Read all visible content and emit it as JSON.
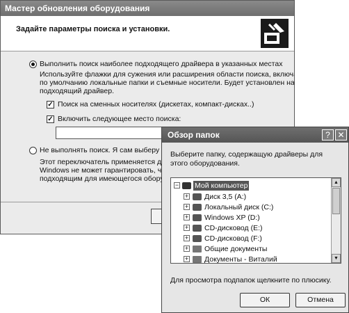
{
  "wizard": {
    "title": "Мастер обновления оборудования",
    "header_title": "Задайте параметры поиска и установки.",
    "option1_label": "Выполнить поиск наиболее подходящего драйвера в указанных местах",
    "option1_desc": [
      "Используйте флажки для сужения или расширения области поиска, включающей",
      "по умолчанию локальные папки и съемные носители. Будет установлен наиболее",
      "подходящий драйвер."
    ],
    "check_removable_label": "Поиск на сменных носителях (дискетах, компакт-дисках..)",
    "check_include_label": "Включить следующее место поиска:",
    "path_value": "",
    "option2_label": "Не выполнять поиск. Я сам выберу нужн",
    "option2_desc": [
      "Этот переключатель применяется для вы",
      "Windows не может гарантировать, что вы",
      "подходящим для имеющегося оборудова"
    ]
  },
  "browse": {
    "title": "Обзор папок",
    "help_btn": "?",
    "close_btn": "✕",
    "description": "Выберите папку, содержащую драйверы для этого оборудования.",
    "tree": [
      {
        "label": "Мой компьютер",
        "expander": "−",
        "icon": "computer-icon",
        "selected": true
      },
      {
        "label": "Диск 3,5 (A:)",
        "expander": "+",
        "icon": "floppy-drive-icon"
      },
      {
        "label": "Локальный диск (C:)",
        "expander": "+",
        "icon": "hard-drive-icon"
      },
      {
        "label": "Windows XP (D:)",
        "expander": "+",
        "icon": "hard-drive-icon"
      },
      {
        "label": "CD-дисковод (E:)",
        "expander": "+",
        "icon": "cd-drive-icon"
      },
      {
        "label": "CD-дисковод (F:)",
        "expander": "+",
        "icon": "cd-drive-icon"
      },
      {
        "label": "Общие документы",
        "expander": "+",
        "icon": "folder-icon"
      },
      {
        "label": "Документы - Виталий",
        "expander": "+",
        "icon": "folder-icon"
      }
    ],
    "hint": "Для просмотра подпапок щелкните по плюсику.",
    "ok_label": "ОК",
    "cancel_label": "Отмена"
  }
}
